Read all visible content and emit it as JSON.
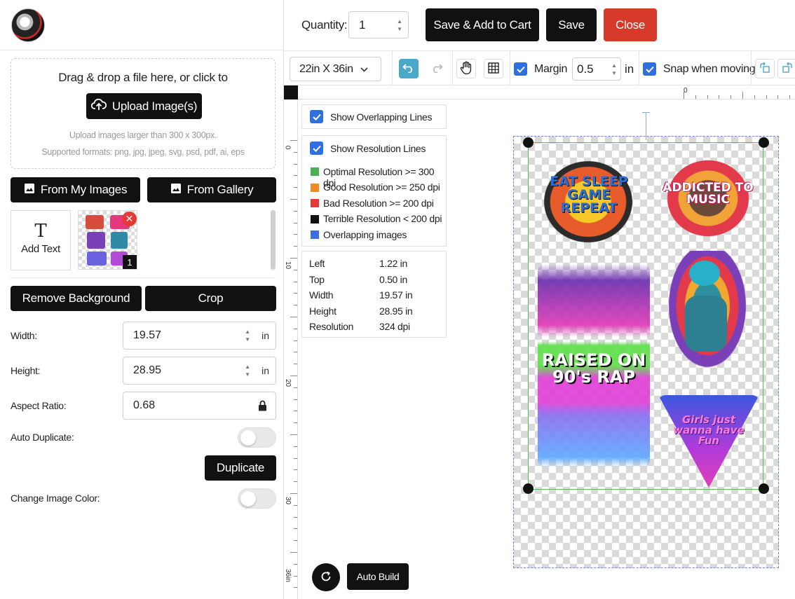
{
  "left_panel": {
    "dropzone": {
      "title": "Drag & drop a file here, or click to",
      "upload_label": "Upload Image(s)",
      "hint_size": "Upload images larger than 300 x 300px.",
      "hint_formats": "Supported formats: png, jpg, jpeg, svg, psd, pdf, ai, eps"
    },
    "from_my_images": "From My Images",
    "from_gallery": "From Gallery",
    "add_text": "Add Text",
    "add_text_glyph": "T",
    "thumb_count": "1",
    "remove_background": "Remove Background",
    "crop": "Crop",
    "width_label": "Width:",
    "width_value": "19.57",
    "height_label": "Height:",
    "height_value": "28.95",
    "unit": "in",
    "aspect_label": "Aspect Ratio:",
    "aspect_value": "0.68",
    "auto_duplicate_label": "Auto Duplicate:",
    "duplicate": "Duplicate",
    "change_color_label": "Change Image Color:"
  },
  "topbar": {
    "quantity_label": "Quantity:",
    "quantity_value": "1",
    "save_add_cart": "Save & Add to Cart",
    "save": "Save",
    "close": "Close",
    "close_color": "#d7392b"
  },
  "toolbar": {
    "size": "22in X 36in",
    "margin_label": "Margin",
    "margin_value": "0.5",
    "margin_unit": "in",
    "snap_label": "Snap when moving",
    "accent": "#2f6fe0",
    "undo_color": "#4aa8c8"
  },
  "canvas": {
    "ruler_top_numbers": [
      "0"
    ],
    "ruler_left_numbers": [
      "0",
      "10",
      "20",
      "30",
      "36in"
    ],
    "show_overlapping_label": "Show Overlapping Lines",
    "show_resolution_label": "Show Resolution Lines",
    "legend": [
      {
        "label": "Optimal Resolution >= 300 dpi",
        "color": "#4caf50"
      },
      {
        "label": "Good Resolution >= 250 dpi",
        "color": "#f08a24"
      },
      {
        "label": "Bad Resolution >= 200 dpi",
        "color": "#e53935"
      },
      {
        "label": "Terrible Resolution < 200 dpi",
        "color": "#111111"
      },
      {
        "label": "Overlapping images",
        "color": "#3a6fe0"
      }
    ],
    "info": [
      {
        "key": "Left",
        "value": "1.22 in"
      },
      {
        "key": "Top",
        "value": "0.50 in"
      },
      {
        "key": "Width",
        "value": "19.57 in"
      },
      {
        "key": "Height",
        "value": "28.95 in"
      },
      {
        "key": "Resolution",
        "value": "324 dpi"
      }
    ],
    "designs": [
      {
        "text": "EAT SLEEP GAME REPEAT"
      },
      {
        "text": "ADDICTED TO MUSIC"
      },
      {
        "text": "RAISED ON 90's RAP"
      },
      {
        "text": "Girls just wanna have Fun"
      }
    ],
    "auto_build": "Auto Build"
  }
}
